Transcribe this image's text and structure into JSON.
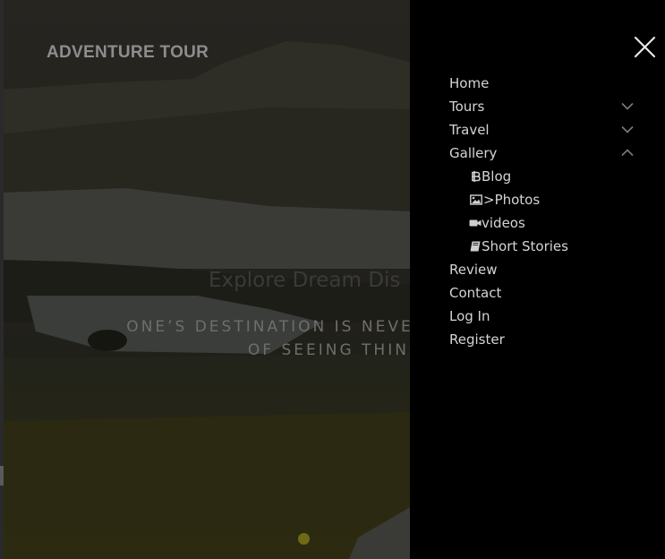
{
  "hero": {
    "brand": "ADVENTURE TOUR",
    "title": "Explore Dream Dis",
    "subtitle_line1": "ONE’S DESTINATION IS NEVER A PLA",
    "subtitle_line2": "OF SEEING THING"
  },
  "menu": {
    "close_icon": "close-icon",
    "items": [
      {
        "label": "Home"
      },
      {
        "label": "Tours",
        "icon": "chevron-down-icon"
      },
      {
        "label": "Travel",
        "icon": "chevron-down-icon"
      },
      {
        "label": "Gallery",
        "icon": "chevron-up-icon",
        "expanded": true
      },
      {
        "label": "Blog",
        "icon": "bitcoin-icon",
        "sub": true
      },
      {
        "label": ">Photos",
        "icon": "image-icon",
        "sub": true
      },
      {
        "label": "videos",
        "icon": "video-camera-icon",
        "sub": true
      },
      {
        "label": "Short Stories",
        "icon": "book-icon",
        "sub": true
      },
      {
        "label": "Review"
      },
      {
        "label": "Contact"
      },
      {
        "label": "Log In"
      },
      {
        "label": "Register"
      }
    ]
  },
  "colors": {
    "menu_background": "#000000",
    "menu_text": "#d4d4d4",
    "brand_text": "#8d8d8d",
    "slider_dot": "#6f6a16"
  }
}
